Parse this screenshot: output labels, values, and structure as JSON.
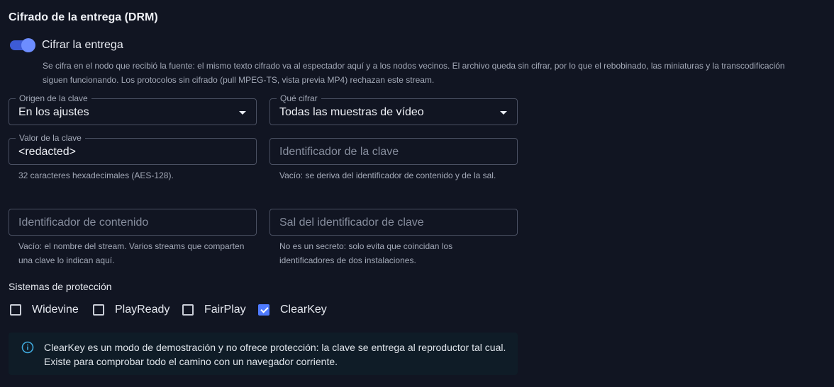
{
  "section": {
    "title": "Cifrado de la entrega (DRM)"
  },
  "toggle": {
    "label": "Cifrar la entrega",
    "enabled": true,
    "help": "Se cifra en el nodo que recibió la fuente: el mismo texto cifrado va al espectador aquí y a los nodos vecinos. El archivo queda sin cifrar, por lo que el rebobinado, las miniaturas y la transcodificación siguen funcionando. Los protocolos sin cifrado (pull MPEG-TS, vista previa MP4) rechazan este stream."
  },
  "fields": {
    "key_source": {
      "label": "Origen de la clave",
      "value": "En los ajustes"
    },
    "encrypt_scope": {
      "label": "Qué cifrar",
      "value": "Todas las muestras de vídeo"
    },
    "key_value": {
      "label": "Valor de la clave",
      "value": "<redacted>",
      "hint": "32 caracteres hexadecimales (AES-128)."
    },
    "key_id": {
      "placeholder": "Identificador de la clave",
      "hint": "Vacío: se deriva del identificador de contenido y de la sal."
    },
    "content_id": {
      "placeholder": "Identificador de contenido",
      "hint": "Vacío: el nombre del stream. Varios streams que comparten una clave lo indican aquí."
    },
    "key_id_salt": {
      "placeholder": "Sal del identificador de clave",
      "hint": "No es un secreto: solo evita que coincidan los identificadores de dos instalaciones."
    }
  },
  "protection": {
    "label": "Sistemas de protección",
    "systems": [
      {
        "label": "Widevine",
        "checked": false
      },
      {
        "label": "PlayReady",
        "checked": false
      },
      {
        "label": "FairPlay",
        "checked": false
      },
      {
        "label": "ClearKey",
        "checked": true
      }
    ]
  },
  "alert": {
    "icon": "info-icon",
    "text": "ClearKey es un modo de demostración y no ofrece protección: la clave se entrega al reproductor tal cual. Existe para comprobar todo el camino con un navegador corriente."
  },
  "colors": {
    "background": "#111522",
    "accent": "#4f7bff",
    "info": "#3fa9dc"
  }
}
